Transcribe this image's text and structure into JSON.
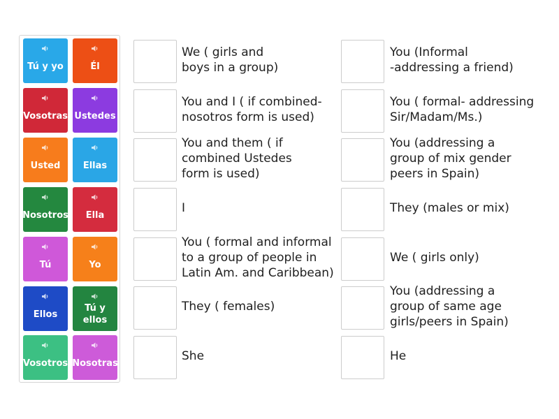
{
  "tiles": [
    {
      "label": "Tú y yo",
      "color": "#29a8e8",
      "icon": "speaker-icon"
    },
    {
      "label": "Él",
      "color": "#ed4f15",
      "icon": "speaker-icon"
    },
    {
      "label": "Vosotras",
      "color": "#d02838",
      "icon": "speaker-icon"
    },
    {
      "label": "Ustedes",
      "color": "#8c3be0",
      "icon": "speaker-icon"
    },
    {
      "label": "Usted",
      "color": "#f77c1c",
      "icon": "speaker-icon"
    },
    {
      "label": "Ellas",
      "color": "#2aa6e6",
      "icon": "speaker-icon"
    },
    {
      "label": "Nosotros",
      "color": "#24883f",
      "icon": "speaker-icon"
    },
    {
      "label": "Ella",
      "color": "#d42c3e",
      "icon": "speaker-icon"
    },
    {
      "label": "Tú",
      "color": "#cf58d9",
      "icon": "speaker-icon"
    },
    {
      "label": "Yo",
      "color": "#f6801a",
      "icon": "speaker-icon"
    },
    {
      "label": "Ellos",
      "color": "#1e4bc6",
      "icon": "speaker-icon"
    },
    {
      "label": "Tú y\nellos",
      "color": "#238540",
      "icon": "speaker-icon"
    },
    {
      "label": "Vosotros",
      "color": "#3cc083",
      "icon": "speaker-icon"
    },
    {
      "label": "Nosotras",
      "color": "#cd5bd9",
      "icon": "speaker-icon"
    }
  ],
  "left_descriptions": [
    "We ( girls and\nboys in a group)",
    "You and I ( if combined-\nnosotros form is used)",
    "You and them ( if\ncombined Ustedes\nform is used)",
    "I",
    "You ( formal and informal\nto a group of people in\nLatin Am. and Caribbean)",
    "They ( females)",
    "She"
  ],
  "right_descriptions": [
    "You (Informal\n-addressing a friend)",
    "You ( formal- addressing\nSir/Madam/Ms.)",
    "You (addressing a\ngroup of mix gender\npeers in Spain)",
    "They (males or mix)",
    "We ( girls only)",
    "You (addressing a\ngroup of same age\ngirls/peers in Spain)",
    "He"
  ]
}
